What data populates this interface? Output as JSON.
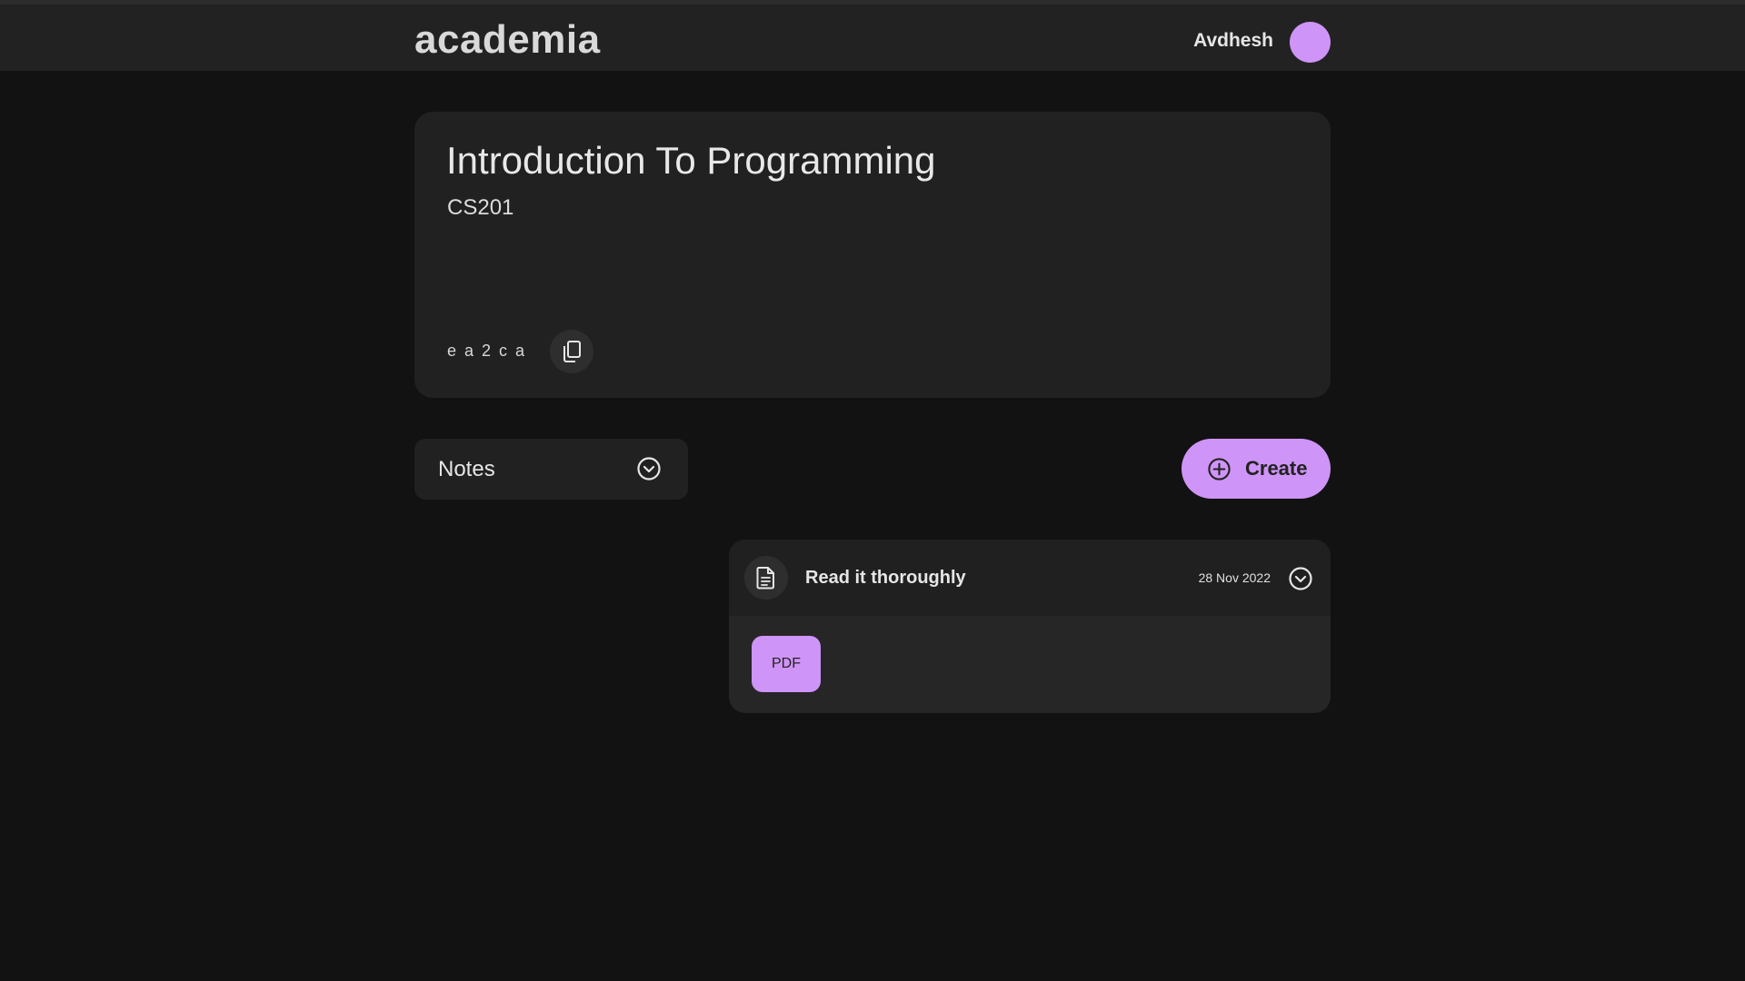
{
  "header": {
    "brand": "academia",
    "user_name": "Avdhesh",
    "avatar_color": "#cf94f7"
  },
  "course": {
    "title": "Introduction To Programming",
    "code": "CS201",
    "class_code": "ea2ca",
    "copy_icon": "copy-icon"
  },
  "filter": {
    "selected": "Notes",
    "icon": "chevron-down-icon"
  },
  "actions": {
    "create_label": "Create",
    "create_icon": "plus-circle-icon"
  },
  "notes": [
    {
      "title": "Read it thoroughly",
      "date": "28 Nov 2022",
      "icon": "document-icon",
      "attachment_label": "PDF"
    }
  ],
  "colors": {
    "accent": "#cf94f7",
    "background": "#121212",
    "surface": "#212121"
  }
}
